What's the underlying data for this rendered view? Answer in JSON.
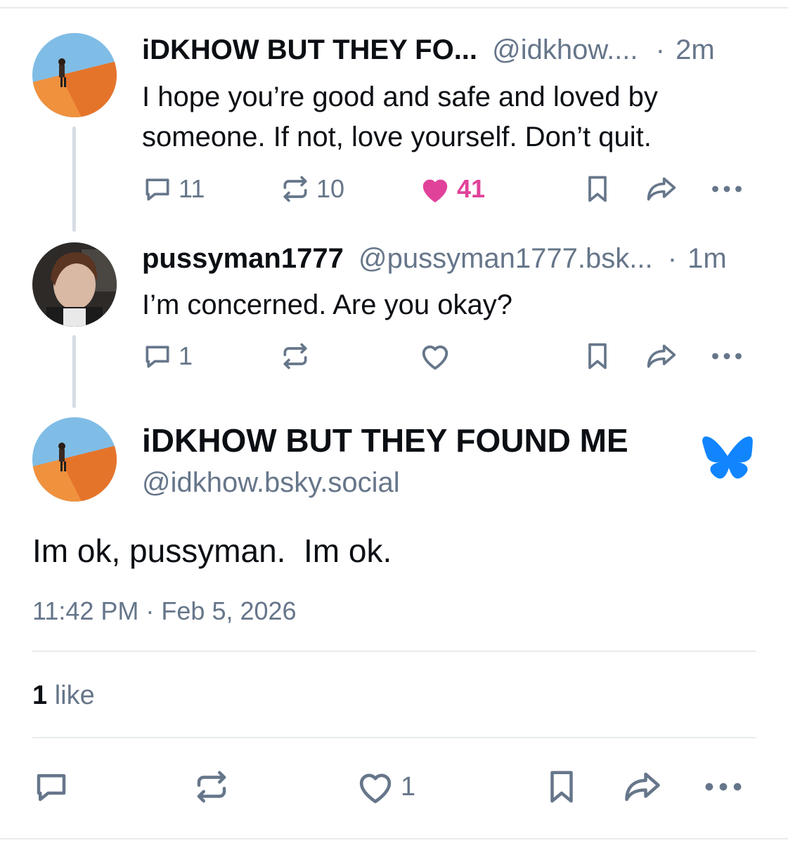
{
  "posts": [
    {
      "display_name": "iDKHOW BUT THEY FO...",
      "handle": "@idkhow....",
      "separator": "·",
      "time": "2m",
      "text": "I hope you’re good and safe and loved by someone. If not, love yourself. Don’t quit.",
      "replies": "11",
      "reposts": "10",
      "likes": "41",
      "liked": true
    },
    {
      "display_name": "pussyman1777",
      "handle": "@pussyman1777.bsk...",
      "separator": "·",
      "time": "1m",
      "text": "I’m concerned. Are you okay?",
      "replies": "1",
      "reposts": "",
      "likes": "",
      "liked": false
    }
  ],
  "main_post": {
    "display_name": "iDKHOW BUT THEY FOUND ME",
    "handle": "@idkhow.bsky.social",
    "text": "Im ok, pussyman.  Im ok.",
    "timestamp": "11:42 PM · Feb 5, 2026",
    "like_count": "1",
    "like_label": "like",
    "action_like_count": "1"
  },
  "icons": {
    "reply": "reply-bubble-icon",
    "repost": "repost-icon",
    "like": "heart-icon",
    "bookmark": "bookmark-icon",
    "share": "share-arrow-icon",
    "more": "more-dots-icon",
    "verified_app": "bluesky-butterfly-icon"
  },
  "colors": {
    "text_primary": "#0b0f14",
    "text_secondary": "#66768a",
    "like_pink": "#e0429a",
    "bluesky_blue": "#1185fe",
    "thread_line": "#d6dde4"
  }
}
